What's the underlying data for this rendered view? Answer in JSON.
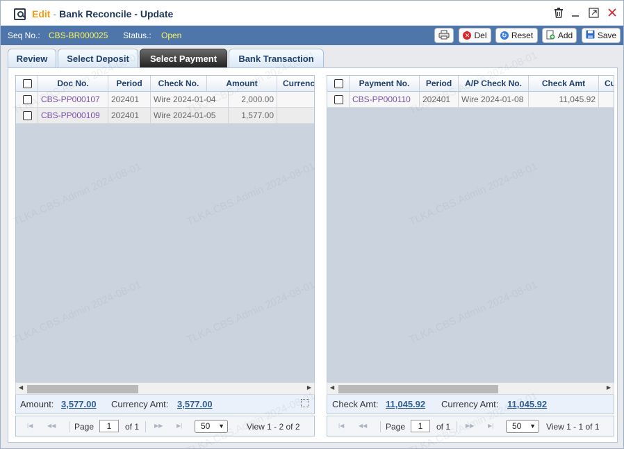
{
  "window": {
    "mode": "Edit",
    "separator": "-",
    "title": "Bank Reconcile - Update",
    "controls": [
      "trash-icon",
      "minimize-icon",
      "maximize-icon",
      "close-icon"
    ]
  },
  "info": {
    "seq_label": "Seq No.:",
    "seq_value": "CBS-BR000025",
    "status_label": "Status.:",
    "status_value": "Open"
  },
  "toolbar": {
    "del_label": "Del",
    "reset_label": "Reset",
    "add_label": "Add",
    "save_label": "Save"
  },
  "tabs": [
    {
      "label": "Review"
    },
    {
      "label": "Select Deposit"
    },
    {
      "label": "Select Payment",
      "active": true
    },
    {
      "label": "Bank Transaction"
    }
  ],
  "left_grid": {
    "columns": [
      "Doc No.",
      "Period",
      "Check No.",
      "Amount",
      "Currenc"
    ],
    "rows": [
      {
        "doc_no": "CBS-PP000107",
        "period": "202401",
        "check_no": "Wire 2024-01-04",
        "amount": "2,000.00"
      },
      {
        "doc_no": "CBS-PP000109",
        "period": "202401",
        "check_no": "Wire 2024-01-05",
        "amount": "1,577.00"
      }
    ],
    "footer": {
      "amount_label": "Amount:",
      "amount_value": "3,577.00",
      "currency_label": "Currency Amt:",
      "currency_value": "3,577.00"
    },
    "pager": {
      "page_label": "Page",
      "page": "1",
      "of_label": "of 1",
      "page_size": "50",
      "view_text": "View 1 - 2 of 2"
    }
  },
  "right_grid": {
    "columns": [
      "Payment No.",
      "Period",
      "A/P Check No.",
      "Check Amt",
      "Cu"
    ],
    "rows": [
      {
        "payment_no": "CBS-PP000110",
        "period": "202401",
        "ap_check_no": "Wire 2024-01-08",
        "check_amt": "11,045.92"
      }
    ],
    "footer": {
      "check_label": "Check Amt:",
      "check_value": "11,045.92",
      "currency_label": "Currency Amt:",
      "currency_value": "11,045.92"
    },
    "pager": {
      "page_label": "Page",
      "page": "1",
      "of_label": "of 1",
      "page_size": "50",
      "view_text": "View 1 - 1 of 1"
    }
  },
  "watermark": "TLKA.CBS.Admin 2024-08-01",
  "colors": {
    "header_blue": "#4f76ab",
    "seq_value": "#f9f25a",
    "mode_orange": "#f39c12",
    "link_purple": "#7a4fa8",
    "footer_value": "#2f5e92"
  }
}
